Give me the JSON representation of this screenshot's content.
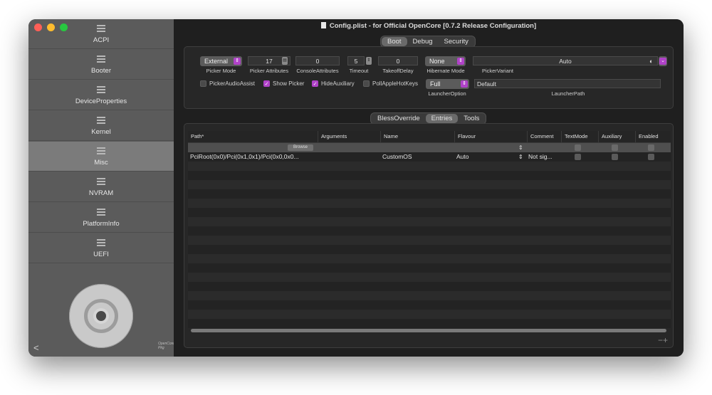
{
  "window": {
    "title": "Config.plist - for Official OpenCore [0.7.2 Release Configuration]"
  },
  "sidebar": {
    "items": [
      {
        "label": "ACPI"
      },
      {
        "label": "Booter"
      },
      {
        "label": "DeviceProperties"
      },
      {
        "label": "Kernel"
      },
      {
        "label": "Misc"
      },
      {
        "label": "NVRAM"
      },
      {
        "label": "PlatformInfo"
      },
      {
        "label": "UEFI"
      }
    ],
    "selected": "Misc",
    "share_icon": "share-icon",
    "logo_text": "OpenCore Pkg"
  },
  "top_tabs": [
    "Boot",
    "Debug",
    "Security"
  ],
  "top_tab_selected": "Boot",
  "boot": {
    "picker_mode": {
      "value": "External",
      "label": "Picker Mode"
    },
    "picker_attributes": {
      "value": "17",
      "label": "Picker Attributes"
    },
    "console_attributes": {
      "value": "0",
      "label": "ConsoleAttributes"
    },
    "timeout": {
      "value": "5",
      "label": "Timeout"
    },
    "takeoff_delay": {
      "value": "0",
      "label": "TakeoffDelay"
    },
    "hibernate_mode": {
      "value": "None",
      "label": "Hibernate Mode"
    },
    "picker_variant": {
      "value": "Auto",
      "label": "PickerVariant"
    },
    "picker_audio_assist": {
      "label": "PickerAudioAssist",
      "checked": false
    },
    "show_picker": {
      "label": "Show Picker",
      "checked": true
    },
    "hide_auxiliary": {
      "label": "HideAuxiliary",
      "checked": true
    },
    "poll_apple_hot_keys": {
      "label": "PollAppleHotKeys",
      "checked": false
    },
    "launcher_option": {
      "value": "Full",
      "label": "LauncherOption"
    },
    "launcher_path": {
      "value": "Default",
      "label": "LauncherPath"
    }
  },
  "bottom_tabs": [
    "BlessOverride",
    "Entries",
    "Tools"
  ],
  "bottom_tab_selected": "Entries",
  "table": {
    "columns": [
      "Path*",
      "Arguments",
      "Name",
      "Flavour",
      "Comment",
      "TextMode",
      "Auxiliary",
      "Enabled"
    ],
    "browse_label": "Browse",
    "rows": [
      {
        "path": "",
        "arguments": "",
        "name": "",
        "flavour": "",
        "comment": ""
      },
      {
        "path": "PciRoot(0x0)/Pci(0x1,0x1)/Pci(0x0,0x0...",
        "arguments": "",
        "name": "CustomOS",
        "flavour": "Auto",
        "comment": "Not sig..."
      }
    ]
  },
  "footer": {
    "minus_plus": "−+"
  },
  "colors": {
    "accent": "#b042c8"
  }
}
